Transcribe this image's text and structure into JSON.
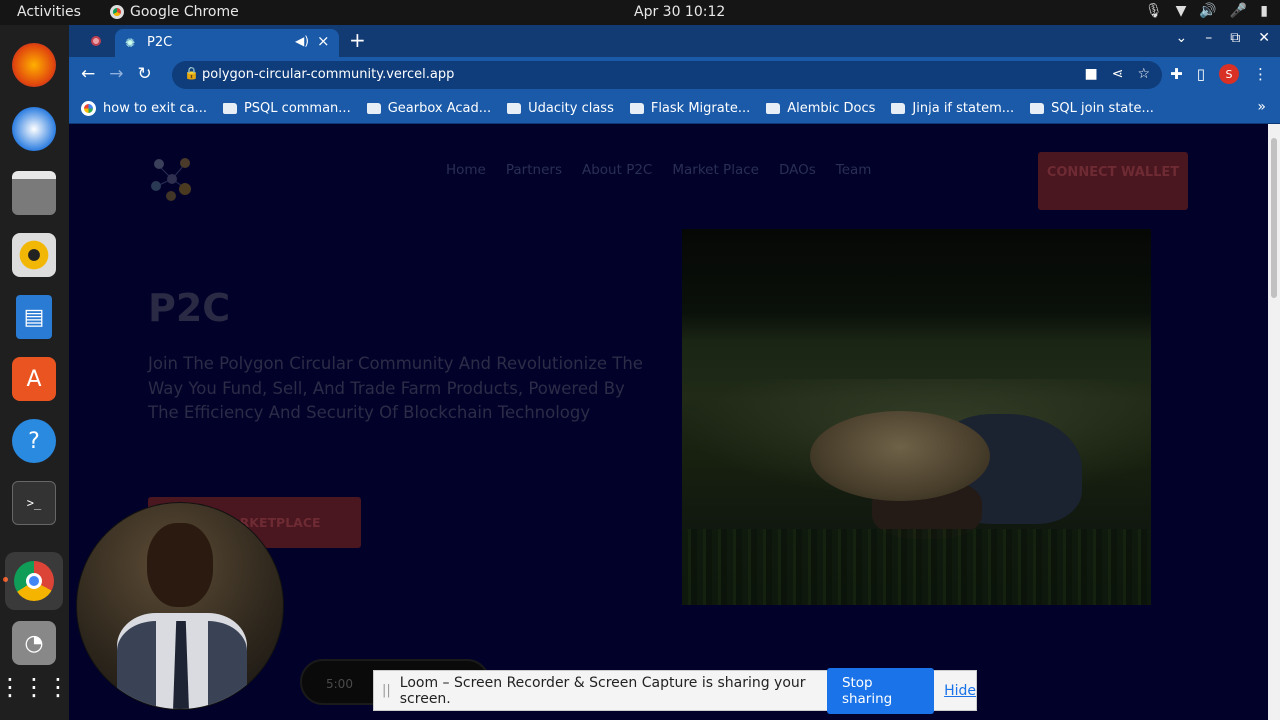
{
  "topbar": {
    "activities": "Activities",
    "app_name": "Google Chrome",
    "clock": "Apr 30  10:12"
  },
  "dock": {
    "apps": [
      "firefox-icon",
      "thunderbird-icon",
      "files-icon",
      "rhythmbox-icon",
      "writer-icon",
      "software-icon",
      "help-icon",
      "terminal-icon",
      "chrome-icon",
      "disks-icon",
      "app-grid-icon"
    ],
    "active_app": "chrome-icon"
  },
  "browser": {
    "tab_title": "P2C",
    "url": "polygon-circular-community.vercel.app",
    "profile_initial": "S",
    "bookmarks": [
      {
        "label": "how to exit ca...",
        "type": "google"
      },
      {
        "label": "PSQL comman...",
        "type": "folder"
      },
      {
        "label": "Gearbox Acad...",
        "type": "folder"
      },
      {
        "label": "Udacity class",
        "type": "folder"
      },
      {
        "label": "Flask Migrate...",
        "type": "folder"
      },
      {
        "label": "Alembic Docs",
        "type": "folder"
      },
      {
        "label": "Jinja if statem...",
        "type": "folder"
      },
      {
        "label": "SQL join state...",
        "type": "folder"
      }
    ]
  },
  "page": {
    "nav": [
      "Home",
      "Partners",
      "About P2C",
      "Market Place",
      "DAOs",
      "Team"
    ],
    "connect_wallet": "CONNECT WALLET",
    "hero_title": "P2C",
    "hero_text": "Join The Polygon Circular Community And Revolutionize The Way You Fund, Sell, And Trade Farm Products, Powered By The Efficiency And Security Of Blockchain Technology",
    "marketplace_button": "ARKETPLACE",
    "background_color": "#02012a",
    "button_color": "#4a1620"
  },
  "recorder": {
    "timer": "5:00"
  },
  "loom_bar": {
    "message": "Loom – Screen Recorder & Screen Capture is sharing your screen.",
    "stop_label": "Stop sharing",
    "hide_label": "Hide"
  }
}
